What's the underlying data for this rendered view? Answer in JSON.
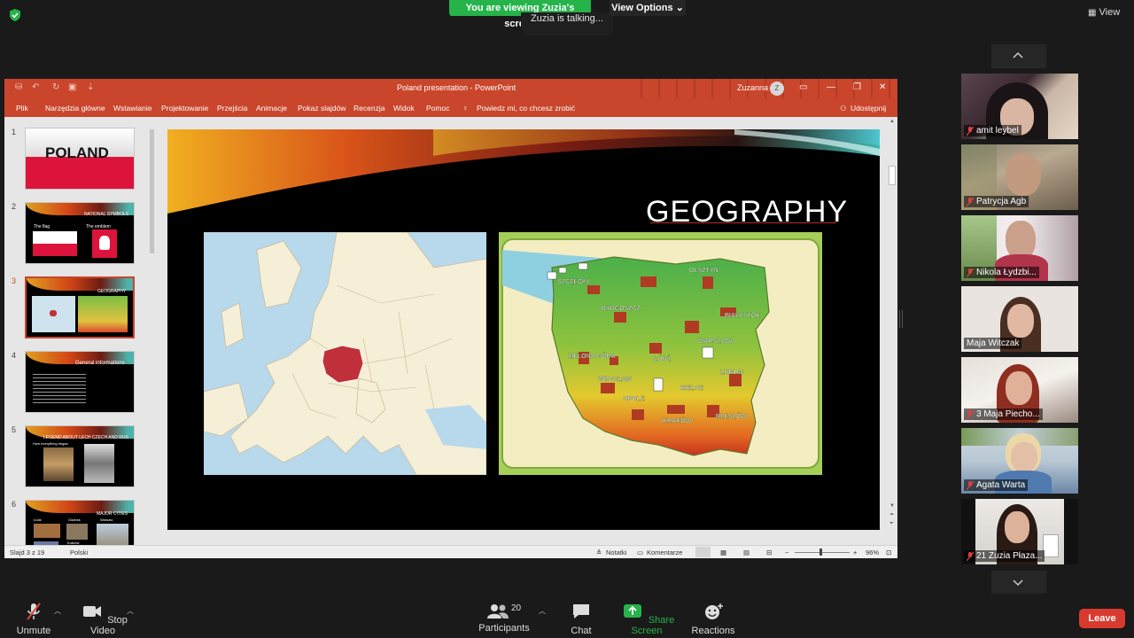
{
  "zoom": {
    "banner_text": "You are viewing Zuzia's screen",
    "talking_text": "Zuzia is talking...",
    "view_options_label": "View Options",
    "view_label": "View",
    "leave_label": "Leave",
    "participants_count": "20",
    "toolbar": {
      "unmute": "Unmute",
      "stop_video": "Stop Video",
      "participants": "Participants",
      "chat": "Chat",
      "share_screen": "Share Screen",
      "reactions": "Reactions"
    }
  },
  "ppt": {
    "window_title": "Poland presentation - PowerPoint",
    "user_name": "Zuzanna",
    "user_avatar": "Z",
    "ribbon": [
      "Plik",
      "Narzędzia główne",
      "Wstawianie",
      "Projektowanie",
      "Przejścia",
      "Animacje",
      "Pokaz slajdów",
      "Recenzja",
      "Widok",
      "Pomoc"
    ],
    "tell_me": "Powiedz mi, co chcesz zrobić",
    "share": "Udostępnij",
    "slides": [
      {
        "num": "1",
        "title": "POLAND"
      },
      {
        "num": "2",
        "title": "NATIONAL SYMBOLS",
        "a": "The flag",
        "b": "The emblem"
      },
      {
        "num": "3",
        "title": "GEOGRAPHY"
      },
      {
        "num": "4",
        "title": "General informations"
      },
      {
        "num": "5",
        "title": "LEGEND ABOUT LECH CZECH AND RUS",
        "a": "How everything began"
      },
      {
        "num": "6",
        "title": "MAJOR CITIES",
        "a": "Łódź",
        "b": "Gdańsk",
        "c": "Warsaw",
        "d": "Kraków"
      }
    ],
    "current_slide_title": "GEOGRAPHY",
    "map_cities": [
      "SZCZECIN",
      "OLSZTYN",
      "BYDGOSZCZ",
      "BIAŁYSTOK",
      "WARSZAWA",
      "ZIELONA GÓRA",
      "ŁÓDŹ",
      "LUBLIN",
      "WROCŁAW",
      "KIELCE",
      "OPOLE",
      "KRAKÓW",
      "RZESZÓW"
    ],
    "status": {
      "slide_info": "Slajd 3 z 19",
      "language": "Polski",
      "notes": "Notatki",
      "comments": "Komentarze",
      "zoom": "96%"
    }
  },
  "participants": [
    {
      "name": "amit leybel",
      "muted": true
    },
    {
      "name": "Patrycja Agb",
      "muted": true
    },
    {
      "name": "Nikola Łydzbi...",
      "muted": true
    },
    {
      "name": "Maja Witczak",
      "muted": false
    },
    {
      "name": "3 Maja Piecho...",
      "muted": true
    },
    {
      "name": "Agata Warta",
      "muted": true
    },
    {
      "name": "21 Zuzia Płaza...",
      "muted": true
    }
  ],
  "colors": {
    "ppt_accent": "#c9452b",
    "share_green": "#26b34a",
    "leave_red": "#d93a2f",
    "poland_red": "#c0303a"
  }
}
